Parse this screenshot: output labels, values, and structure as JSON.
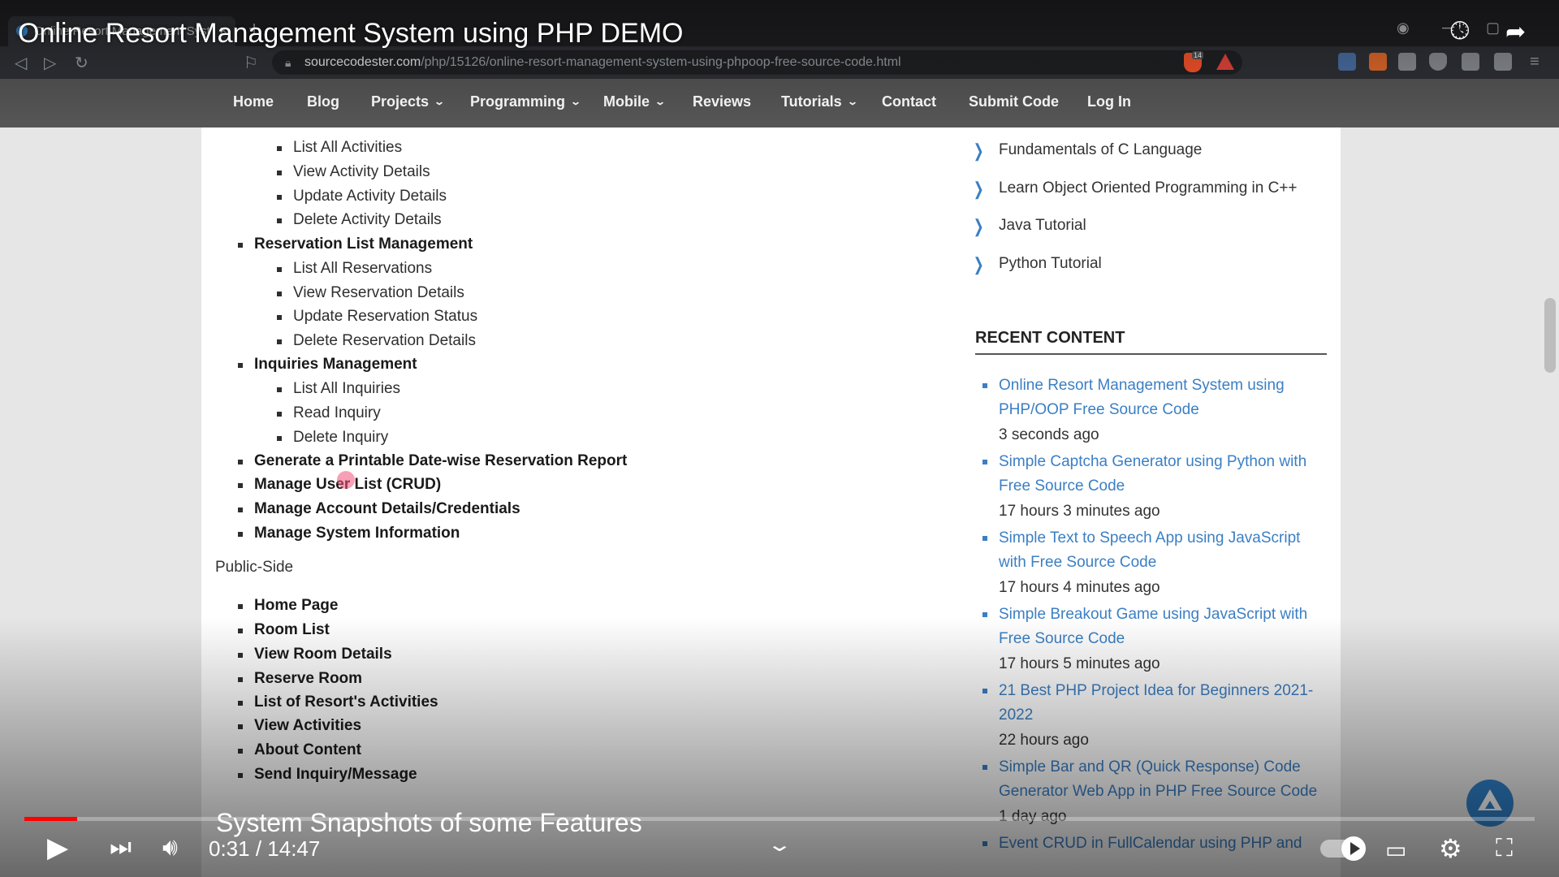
{
  "browser": {
    "tab_title": "Online Resort Management Syst",
    "tab_close": "×",
    "new_tab": "+",
    "url_domain": "sourcecodester.com",
    "url_path": "/php/15126/online-resort-management-system-using-phpoop-free-source-code.html",
    "brave_badge": "14"
  },
  "site_nav": {
    "items": [
      {
        "label": "Home"
      },
      {
        "label": "Blog"
      },
      {
        "label": "Projects"
      },
      {
        "label": "Programming"
      },
      {
        "label": "Mobile"
      },
      {
        "label": "Reviews"
      },
      {
        "label": "Tutorials"
      },
      {
        "label": "Contact"
      },
      {
        "label": "Submit Code"
      },
      {
        "label": "Log In"
      }
    ]
  },
  "article": {
    "activities_sub": [
      "List All Activities",
      "View Activity Details",
      "Update Activity Details",
      "Delete Activity Details"
    ],
    "reservation_heading": "Reservation List Management",
    "reservation_sub": [
      "List All Reservations",
      "View Reservation Details",
      "Update Reservation Status",
      "Delete Reservation Details"
    ],
    "inquiries_heading": "Inquiries Management",
    "inquiries_sub": [
      "List All Inquiries",
      "Read Inquiry",
      "Delete Inquiry"
    ],
    "admin_rest": [
      "Generate a Printable Date-wise Reservation Report",
      "Manage User List (CRUD)",
      "Manage Account Details/Credentials",
      "Manage System Information"
    ],
    "public_heading": "Public-Side",
    "public_items": [
      "Home Page",
      "Room List",
      "View Room Details",
      "Reserve Room",
      "List of Resort's Activities",
      "View Activities",
      "About Content",
      "Send Inquiry/Message"
    ]
  },
  "sidebar": {
    "tutorial_links": [
      "Fundamentals of C Language",
      "Learn Object Oriented Programming in C++",
      "Java Tutorial",
      "Python Tutorial"
    ],
    "recent_title": "RECENT CONTENT",
    "recent_items": [
      {
        "title": "Online Resort Management System using PHP/OOP Free Source Code",
        "time": "3 seconds ago"
      },
      {
        "title": "Simple Captcha Generator using Python with Free Source Code",
        "time": "17 hours 3 minutes ago"
      },
      {
        "title": "Simple Text to Speech App using JavaScript with Free Source Code",
        "time": "17 hours 4 minutes ago"
      },
      {
        "title": "Simple Breakout Game using JavaScript with Free Source Code",
        "time": "17 hours 5 minutes ago"
      },
      {
        "title": "21 Best PHP Project Idea for Beginners 2021-2022",
        "time": "22 hours ago"
      },
      {
        "title": "Simple Bar and QR (Quick Response) Code Generator Web App in PHP Free Source Code",
        "time": "1 day ago"
      },
      {
        "title": "Event CRUD in FullCalendar using PHP and"
      }
    ]
  },
  "video": {
    "title": "Online Resort Management System using PHP DEMO",
    "chapter": "System Snapshots of some Features",
    "time_display": "0:31 / 14:47",
    "progress_fraction": 0.035
  }
}
